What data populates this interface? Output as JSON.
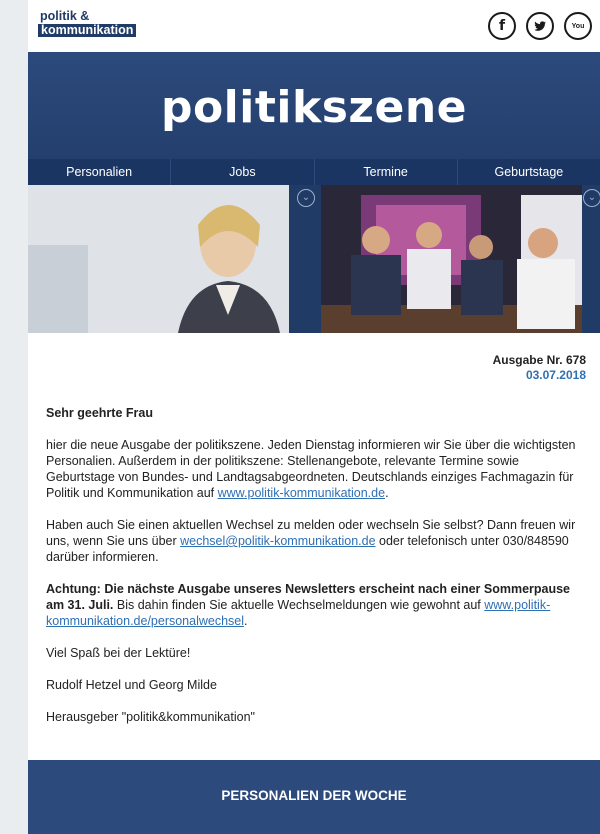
{
  "header": {
    "logo_line1": "politik &",
    "logo_line2": "kommunikation",
    "social": [
      {
        "icon": "facebook-icon",
        "glyph": "f"
      },
      {
        "icon": "twitter-icon",
        "glyph": ""
      },
      {
        "icon": "youtube-icon",
        "glyph": "You"
      }
    ]
  },
  "banner": {
    "title": "politikszene"
  },
  "nav": {
    "items": [
      "Personalien",
      "Jobs",
      "Termine",
      "Geburtstage"
    ]
  },
  "issue": {
    "number": "Ausgabe Nr. 678",
    "date": "03.07.2018"
  },
  "body": {
    "greeting": "Sehr geehrte Frau",
    "p1_text": "hier die neue Ausgabe der politikszene. Jeden Dienstag informieren wir Sie über die wichtigsten Personalien. Außerdem in der politikszene: Stellenangebote, relevante Termine sowie Geburtstage von Bundes- und Landtagsabgeordneten.  Deutschlands einziges Fachmagazin für Politik und Kommunikation auf ",
    "p1_link": "www.politik-kommunikation.de",
    "p1_end": ".",
    "p2_text": "Haben auch Sie einen aktuellen Wechsel zu melden oder wechseln Sie selbst? Dann freuen wir uns, wenn Sie uns über ",
    "p2_link": "wechsel@politik-kommunikation.de",
    "p2_end": " oder telefonisch unter 030/848590  darüber informieren.",
    "p3_bold": "Achtung: Die nächste Ausgabe unseres Newsletters erscheint nach einer Sommerpause am 31. Juli.",
    "p3_text": " Bis dahin finden Sie aktuelle Wechselmeldungen wie gewohnt auf ",
    "p3_link": "www.politik-kommunikation.de/personalwechsel",
    "p3_end": ".",
    "p4": "Viel Spaß bei der Lektüre!",
    "p5": "Rudolf Hetzel und Georg Milde",
    "p6": "Herausgeber \"politik&kommunikation\""
  },
  "section": {
    "title": "PERSONALIEN DER WOCHE"
  }
}
